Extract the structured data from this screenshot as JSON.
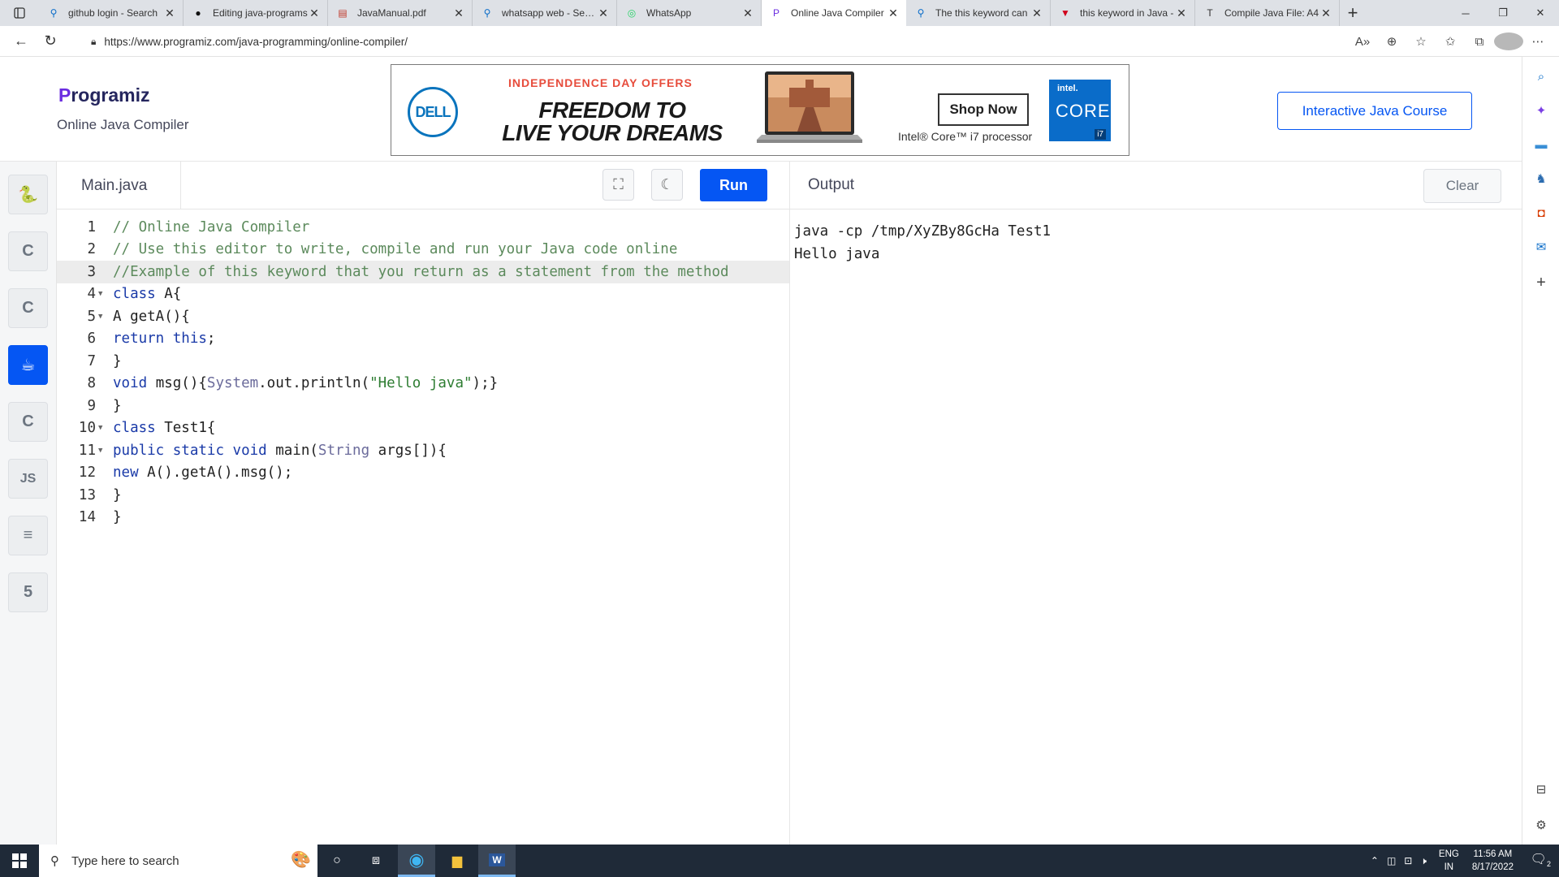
{
  "browser": {
    "tabs": [
      {
        "title": "github login - Search",
        "icon": "search-icon"
      },
      {
        "title": "Editing java-programs",
        "icon": "github-icon"
      },
      {
        "title": "JavaManual.pdf",
        "icon": "pdf-icon"
      },
      {
        "title": "whatsapp web - Search",
        "icon": "search-icon"
      },
      {
        "title": "WhatsApp",
        "icon": "whatsapp-icon"
      },
      {
        "title": "Online Java Compiler",
        "icon": "programiz-icon",
        "active": true
      },
      {
        "title": "The this keyword can",
        "icon": "search-icon"
      },
      {
        "title": "this keyword in Java -",
        "icon": "v-icon"
      },
      {
        "title": "Compile Java File: A4",
        "icon": "text-icon"
      }
    ],
    "url": "https://www.programiz.com/java-programming/online-compiler/"
  },
  "header": {
    "logo": "rogramiz",
    "logo_p": "P",
    "subtitle": "Online Java Compiler",
    "course_button": "Interactive Java Course"
  },
  "ad": {
    "brand": "DELL",
    "offer": "INDEPENDENCE DAY OFFERS",
    "slogan_1": "FREEDOM TO",
    "slogan_2": "LIVE YOUR DREAMS",
    "shop": "Shop Now",
    "processor": "Intel® Core™ i7 processor",
    "intel_1": "intel.",
    "intel_2": "CORE",
    "intel_3": "i7"
  },
  "languages": [
    {
      "name": "python",
      "glyph": "🐍"
    },
    {
      "name": "c",
      "glyph": "C"
    },
    {
      "name": "cpp",
      "glyph": "C"
    },
    {
      "name": "java",
      "glyph": "☕",
      "active": true
    },
    {
      "name": "csharp",
      "glyph": "C"
    },
    {
      "name": "js",
      "glyph": "JS"
    },
    {
      "name": "sql",
      "glyph": "≡"
    },
    {
      "name": "html",
      "glyph": "5"
    }
  ],
  "editor": {
    "filename": "Main.java",
    "run": "Run",
    "lines": [
      {
        "n": "1",
        "text": "// Online Java Compiler",
        "type": "comment"
      },
      {
        "n": "2",
        "text": "// Use this editor to write, compile and run your Java code online",
        "type": "comment"
      },
      {
        "n": "3",
        "text": "//Example of this keyword that you return as a statement from the method",
        "type": "comment",
        "highlight": true
      },
      {
        "n": "4",
        "text": "class A{",
        "fold": true
      },
      {
        "n": "5",
        "text": "A getA(){",
        "fold": true
      },
      {
        "n": "6",
        "text": "return this;"
      },
      {
        "n": "7",
        "text": "}"
      },
      {
        "n": "8",
        "text": "void msg(){System.out.println(\"Hello java\");}"
      },
      {
        "n": "9",
        "text": "}"
      },
      {
        "n": "10",
        "text": "class Test1{",
        "fold": true
      },
      {
        "n": "11",
        "text": "public static void main(String args[]){",
        "fold": true
      },
      {
        "n": "12",
        "text": "new A().getA().msg();"
      },
      {
        "n": "13",
        "text": "}"
      },
      {
        "n": "14",
        "text": "}"
      }
    ]
  },
  "output": {
    "title": "Output",
    "clear": "Clear",
    "text": "java -cp /tmp/XyZBy8GcHa Test1\nHello java"
  },
  "taskbar": {
    "search_placeholder": "Type here to search",
    "lang_1": "ENG",
    "lang_2": "IN",
    "time": "11:56 AM",
    "date": "8/17/2022",
    "notifications": "2"
  },
  "colors": {
    "accent": "#0556f3",
    "taskbar": "#1f2a38"
  }
}
